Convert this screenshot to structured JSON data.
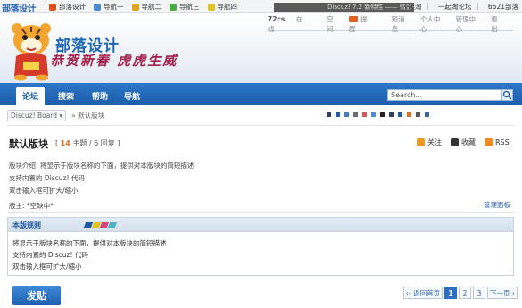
{
  "topbar": {
    "logo": "部落设计",
    "nav": [
      {
        "label": "部落设计",
        "color": "#e24b1b"
      },
      {
        "label": "导航一",
        "color": "#4c8ad6"
      },
      {
        "label": "导航二",
        "color": "#e0a21c"
      },
      {
        "label": "导航三",
        "color": "#4caa44"
      },
      {
        "label": "导航四",
        "color": "#e0c21c"
      }
    ],
    "right_links": [
      "一起淘",
      "一起淘论坛",
      "6621部落"
    ],
    "dark_text": "Discuz! 7.2 新特性 —— 情侣关注"
  },
  "header": {
    "online_count": "72cs",
    "online_label": "在线",
    "links": [
      "空间",
      "提醒",
      "短消息",
      "个人中心",
      "管理中心",
      "退出"
    ],
    "brand_title": "部落设计",
    "brand_sub": "恭贺新春 虎虎生威"
  },
  "navbar": {
    "tabs": [
      "论坛",
      "搜索",
      "帮助",
      "导航"
    ],
    "active_tab": "论坛",
    "search_placeholder": "Search..."
  },
  "breadcrumb": {
    "board": "Discuz! Board",
    "separator": "»",
    "current": "默认版块",
    "swatches": [
      "#33415a",
      "#1f5aa0",
      "#3f7fbf",
      "#6d6d6d",
      "#d65a5a",
      "#4c8ad6",
      "#222222",
      "#33415a",
      "#1f5aa0",
      "#e06d1a",
      "#555555",
      "#3a66a6"
    ]
  },
  "forum": {
    "title": "默认版块",
    "topics": "14",
    "topics_label": "主题",
    "replies": "6",
    "replies_label": "回复",
    "actions": [
      {
        "label": "关注",
        "color": "#e89a26"
      },
      {
        "label": "收藏",
        "color": "#333333"
      },
      {
        "label": "RSS",
        "color": "#f08a24"
      }
    ],
    "description_lines": [
      "版块介绍: 将显示于版块名称的下面，提供对本版块的简短描述",
      "支持内置的 Discuz! 代码",
      "双击输入框可扩大/缩小"
    ],
    "moderator": "版主: *空缺中*",
    "manage_link": "管理面板"
  },
  "rules": {
    "title": "本版规则",
    "bar_colors": [
      "#1f5aa0",
      "#e0c21c",
      "#d6457a",
      "#4cb4c4"
    ],
    "lines": [
      "将显示于版块名称的下面，提供对本版块的简短描述",
      "支持内置的 Discuz! 代码",
      "双击输入框可扩大/缩小"
    ]
  },
  "bottom": {
    "post_button": "发贴",
    "pager": [
      "‹‹ 返回首页",
      "1",
      "2",
      "3",
      "下一页 ›"
    ],
    "current_page": "1"
  }
}
